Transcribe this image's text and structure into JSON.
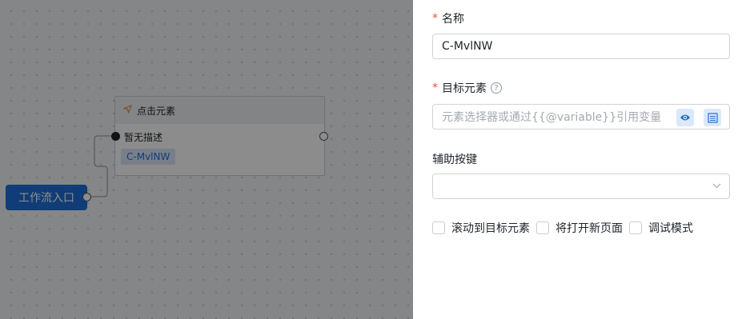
{
  "canvas": {
    "entry_node_label": "工作流入口",
    "action_node": {
      "title": "点击元素",
      "description": "暂无描述",
      "tag": "C-MvlNW"
    }
  },
  "panel": {
    "name_label": "名称",
    "name_value": "C-MvlNW",
    "target_label": "目标元素",
    "target_placeholder": "元素选择器或通过{{@variable}}引用变量",
    "modifier_label": "辅助按键",
    "modifier_value": "",
    "checkboxes": [
      {
        "label": "滚动到目标元素",
        "checked": false
      },
      {
        "label": "将打开新页面",
        "checked": false
      },
      {
        "label": "调试模式",
        "checked": false
      }
    ]
  },
  "colors": {
    "accent": "#1e6fd9",
    "required": "#f54a45",
    "node_icon": "#e8892c"
  },
  "icons": {
    "node": "send-icon",
    "help": "question-circle-icon",
    "preview": "eye-icon",
    "picker": "element-picker-icon",
    "dropdown": "chevron-down-icon"
  }
}
